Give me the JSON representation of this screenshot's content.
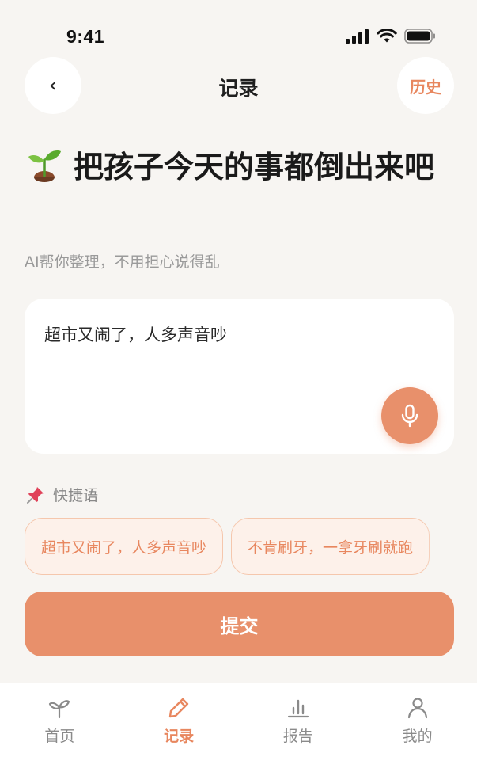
{
  "status_bar": {
    "time": "9:41"
  },
  "header": {
    "back_label": "‹",
    "title": "记录",
    "history_label": "历史"
  },
  "intro": {
    "icon": "sprout-icon",
    "headline": "把孩子今天的事都倒出来吧",
    "subtitle": "AI帮你整理，不用担心说得乱"
  },
  "input": {
    "value": "超市又闹了，人多声音吵",
    "mic_icon": "microphone-icon"
  },
  "quick_phrases": {
    "icon": "pushpin-icon",
    "label": "快捷语",
    "items": [
      {
        "text": "超市又闹了，人多声音吵"
      },
      {
        "text": "不肯刷牙，一拿牙刷就跑"
      }
    ]
  },
  "submit": {
    "label": "提交"
  },
  "tab_bar": {
    "items": [
      {
        "label": "首页",
        "icon": "sprout-outline-icon",
        "active": false
      },
      {
        "label": "记录",
        "icon": "pencil-icon",
        "active": true
      },
      {
        "label": "报告",
        "icon": "bar-chart-icon",
        "active": false
      },
      {
        "label": "我的",
        "icon": "person-icon",
        "active": false
      }
    ]
  },
  "colors": {
    "accent": "#e8906b",
    "accent_text": "#e8875f",
    "background": "#f7f5f2",
    "chip_bg": "#fdf1ea",
    "chip_border": "#f5c7ad"
  }
}
